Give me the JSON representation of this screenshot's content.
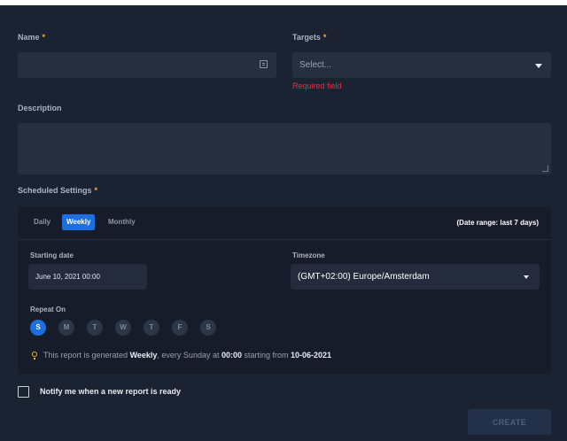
{
  "form": {
    "name": {
      "label": "Name",
      "required_mark": "*",
      "value": "",
      "placeholder": ""
    },
    "targets": {
      "label": "Targets",
      "required_mark": "*",
      "placeholder": "Select...",
      "error": "Required field"
    },
    "description": {
      "label": "Description",
      "value": ""
    }
  },
  "schedule": {
    "label": "Scheduled Settings",
    "required_mark": "*",
    "tabs": [
      {
        "label": "Daily",
        "active": false
      },
      {
        "label": "Weekly",
        "active": true
      },
      {
        "label": "Monthly",
        "active": false
      }
    ],
    "range_text": "(Date range: last 7 days)",
    "starting_date": {
      "label": "Starting date",
      "value": "June 10, 2021 00:00"
    },
    "timezone": {
      "label": "Timezone",
      "value": "(GMT+02:00) Europe/Amsterdam"
    },
    "repeat_on": {
      "label": "Repeat On",
      "days": [
        {
          "label": "S",
          "active": true
        },
        {
          "label": "M",
          "active": false
        },
        {
          "label": "T",
          "active": false
        },
        {
          "label": "W",
          "active": false
        },
        {
          "label": "T",
          "active": false
        },
        {
          "label": "F",
          "active": false
        },
        {
          "label": "S",
          "active": false
        }
      ]
    },
    "info": {
      "prefix": "This report is generated ",
      "frequency": "Weekly",
      "middle": ", every Sunday at ",
      "time": "00:00",
      "suffix": " starting from ",
      "date": "10-06-2021"
    }
  },
  "notify": {
    "label": "Notify me when a new report is ready",
    "checked": false
  },
  "actions": {
    "create_label": "CREATE"
  },
  "colors": {
    "accent": "#1d6fe0",
    "required": "#f2b134",
    "error": "#e2334d",
    "panel": "#1b2231",
    "input": "#262f40"
  },
  "icons": [
    "id-card-icon",
    "chevron-down-icon",
    "resize-grip-icon",
    "lightbulb-icon",
    "checkbox-icon"
  ]
}
